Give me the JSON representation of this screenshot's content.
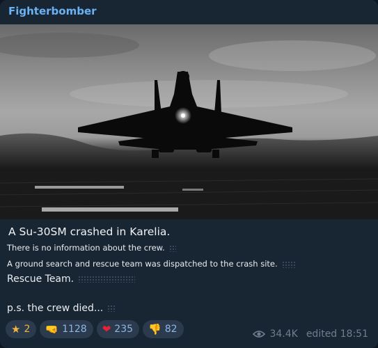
{
  "channel": {
    "name": "Fighterbomber"
  },
  "message": {
    "title": "A Su-30SM crashed in Karelia.",
    "line1": "There is no information about the crew.",
    "line2": "A ground search and rescue team was dispatched to the crash site.",
    "line3": "Rescue Team.",
    "line4": "p.s. the crew died..."
  },
  "reactions": [
    {
      "icon": "star-icon",
      "emoji": "★",
      "count": "2"
    },
    {
      "icon": "pointing-hand-icon",
      "emoji": "🤜",
      "count": "1128"
    },
    {
      "icon": "heart-icon",
      "emoji": "❤",
      "count": "235"
    },
    {
      "icon": "thumbs-down-icon",
      "emoji": "👎",
      "count": "82"
    }
  ],
  "meta": {
    "views": "34.4K",
    "edited": "edited 18:51"
  },
  "colors": {
    "background": "#182533",
    "accent": "#6ab3f3",
    "muted": "#6d7f8f"
  }
}
